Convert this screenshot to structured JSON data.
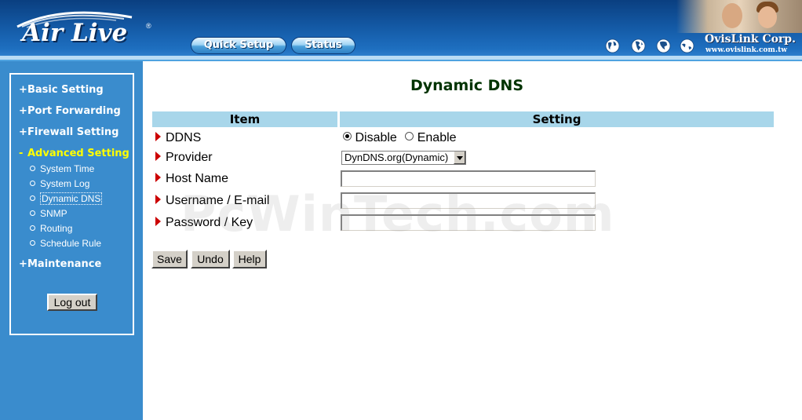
{
  "header": {
    "logo_text": "Air Live",
    "quick_setup_label": "Quick Setup",
    "status_label": "Status",
    "company_name": "OvisLink Corp.",
    "company_url": "www.ovislink.com.tw"
  },
  "sidebar": {
    "items": [
      {
        "prefix": "+",
        "label": "Basic Setting"
      },
      {
        "prefix": "+",
        "label": "Port Forwarding"
      },
      {
        "prefix": "+",
        "label": "Firewall Setting"
      },
      {
        "prefix": "-",
        "label": "Advanced Setting"
      },
      {
        "prefix": "+",
        "label": "Maintenance"
      }
    ],
    "subitems": [
      {
        "label": "System Time"
      },
      {
        "label": "System Log"
      },
      {
        "label": "Dynamic DNS"
      },
      {
        "label": "SNMP"
      },
      {
        "label": "Routing"
      },
      {
        "label": "Schedule Rule"
      }
    ],
    "logout_label": "Log out"
  },
  "main": {
    "title": "Dynamic DNS",
    "headers": {
      "item": "Item",
      "setting": "Setting"
    },
    "rows": {
      "ddns": "DDNS",
      "provider": "Provider",
      "host_name": "Host Name",
      "username": "Username / E-mail",
      "password": "Password / Key"
    },
    "ddns_options": {
      "disable": "Disable",
      "enable": "Enable",
      "selected": "Disable"
    },
    "provider_value": "DynDNS.org(Dynamic)",
    "host_name_value": "",
    "username_value": "",
    "password_value": "",
    "buttons": {
      "save": "Save",
      "undo": "Undo",
      "help": "Help"
    },
    "watermark": "PcWinTech.com"
  },
  "colors": {
    "header_blue": "#145aa6",
    "sidebar_blue": "#3a8ccd",
    "active_menu": "#ffff00",
    "table_header": "#a8d6ea",
    "title_green": "#003300",
    "row_arrow": "#cc0000"
  }
}
